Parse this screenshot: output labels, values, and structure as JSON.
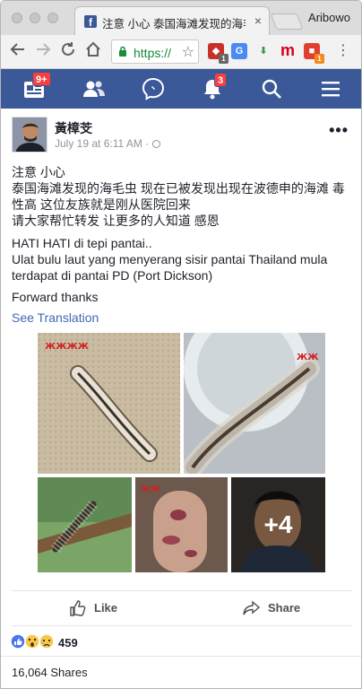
{
  "browser": {
    "tab_title": "注意 小心 泰国海滩发现的海毛",
    "tab_close": "×",
    "profile_name": "Aribowo",
    "url_text": "https://",
    "menu": "⋮",
    "extensions": [
      {
        "name": "shield-extension",
        "color": "#c8302c",
        "badge": "1",
        "badge_color": "#666666"
      },
      {
        "name": "translate-extension",
        "color": "#4a8af4",
        "badge": "",
        "badge_color": ""
      },
      {
        "name": "download-extension",
        "color": "#3c9a3c",
        "badge": "",
        "badge_color": ""
      },
      {
        "name": "m-extension",
        "color": "#ffffff",
        "badge": "",
        "badge_color": ""
      },
      {
        "name": "notes-extension",
        "color": "#e0402e",
        "badge": "1",
        "badge_color": "#f08a1c"
      }
    ],
    "m_letter": "m"
  },
  "fb_nav": {
    "color": "#3b5998",
    "feed_badge": "9+",
    "notif_badge": "3"
  },
  "post": {
    "author": "黃樟芠",
    "time": "July 19 at 6:11 AM · ",
    "more": "•••",
    "paragraphs": [
      "注意 小心",
      "泰国海滩发现的海毛虫 现在已被发现出现在波德申的海滩 毒性高 这位友族就是刚从医院回来",
      "请大家帮忙转发 让更多的人知道 感恩",
      "HATI HATI di tepi pantai..",
      "Ulat bulu laut yang menyerang sisir pantai Thailand mula terdapat di pantai PD (Port Dickson)",
      "Forward thanks"
    ],
    "see_translation": "See Translation",
    "more_photos": "+4",
    "like_label": "Like",
    "share_label": "Share",
    "reaction_count": "459",
    "shares_text": "16,064 Shares"
  }
}
